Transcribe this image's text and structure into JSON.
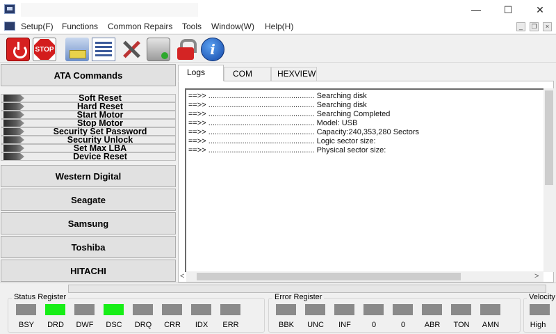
{
  "menu": {
    "items": [
      "Setup(F)",
      "Functions",
      "Common Repairs",
      "Tools",
      "Window(W)",
      "Help(H)"
    ]
  },
  "window_controls": {
    "minimize": "—",
    "maximize": "☐",
    "close": "✕"
  },
  "mdi_controls": {
    "minimize": "_",
    "restore": "❐",
    "close": "×"
  },
  "toolbar": {
    "stop_label": "STOP",
    "info_label": "i",
    "icons": [
      "power-icon",
      "stop-icon",
      "network-icon",
      "list-icon",
      "tools-icon",
      "disk-icon",
      "lock-icon",
      "info-icon"
    ]
  },
  "left_panel": {
    "ata_group": "ATA Commands",
    "ata_commands": [
      "Soft Reset",
      "Hard Reset",
      "Start Motor",
      "Stop Motor",
      "Security Set Password",
      "Security Unlock",
      "Set Max LBA",
      "Device Reset"
    ],
    "groups": [
      "Western Digital",
      "Seagate",
      "Samsung",
      "Toshiba",
      "HITACHI"
    ]
  },
  "tabs": [
    "Logs",
    "COM",
    "HEXVIEW"
  ],
  "active_tab": "Logs",
  "log": {
    "prefix": "==>> ..................................................",
    "lines": [
      "Searching disk",
      "Searching disk",
      "Searching Completed",
      "Model: USB",
      "Capacity:240,353,280 Sectors",
      "Logic sector size:",
      "Physical sector size:"
    ]
  },
  "progress": {
    "fraction": 0.0,
    "color": "#06b025"
  },
  "status_register": {
    "title": "Status Register",
    "bits": [
      {
        "label": "BSY",
        "on": false
      },
      {
        "label": "DRD",
        "on": true
      },
      {
        "label": "DWF",
        "on": false
      },
      {
        "label": "DSC",
        "on": true
      },
      {
        "label": "DRQ",
        "on": false
      },
      {
        "label": "CRR",
        "on": false
      },
      {
        "label": "IDX",
        "on": false
      },
      {
        "label": "ERR",
        "on": false
      }
    ]
  },
  "error_register": {
    "title": "Error Register",
    "bits": [
      {
        "label": "BBK",
        "on": false
      },
      {
        "label": "UNC",
        "on": false
      },
      {
        "label": "INF",
        "on": false
      },
      {
        "label": "0",
        "on": false
      },
      {
        "label": "0",
        "on": false
      },
      {
        "label": "ABR",
        "on": false
      },
      {
        "label": "TON",
        "on": false
      },
      {
        "label": "AMN",
        "on": false
      }
    ]
  },
  "velocity": {
    "title": "Velocity",
    "value": "High"
  },
  "colors": {
    "led_on": "#17ee17",
    "led_off": "#8a8a8a"
  }
}
